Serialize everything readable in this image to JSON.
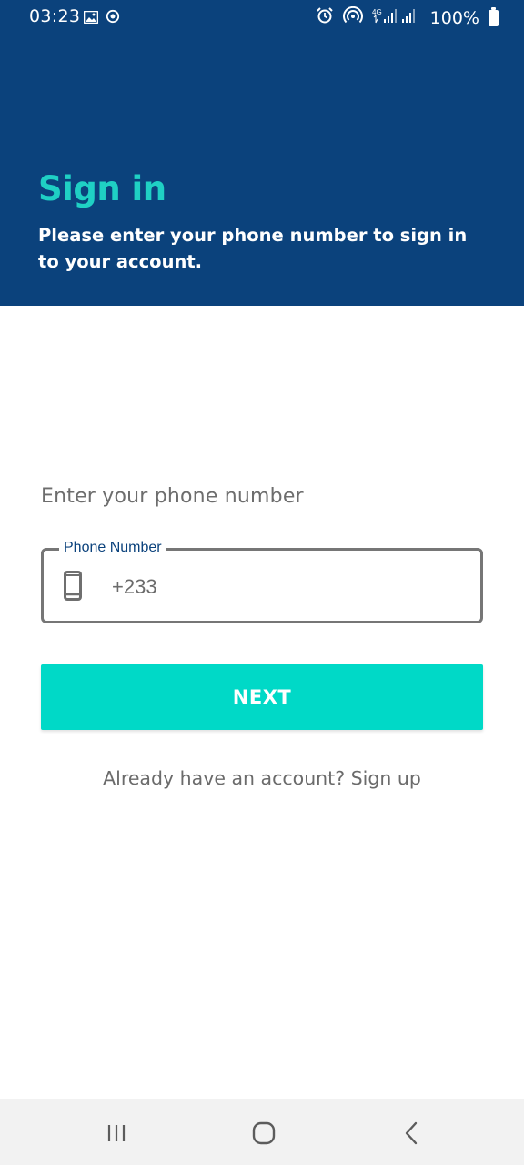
{
  "status_bar": {
    "time": "03:23",
    "network": "4G",
    "battery": "100%"
  },
  "header": {
    "title": "Sign in",
    "subtitle": "Please enter your phone number to sign in to your account."
  },
  "form": {
    "prompt": "Enter your phone number",
    "phone_field": {
      "label": "Phone Number",
      "value": "+233"
    },
    "next_label": "NEXT",
    "signup_text": "Already have an account? Sign up"
  },
  "colors": {
    "header_bg": "#0b427c",
    "accent": "#00d9c7",
    "title": "#1fd0c4"
  },
  "icons": [
    "image-icon",
    "sync-icon",
    "alarm-icon",
    "hotspot-icon",
    "signal-icon",
    "battery-icon",
    "phone-icon",
    "recents-icon",
    "home-icon",
    "back-icon"
  ]
}
